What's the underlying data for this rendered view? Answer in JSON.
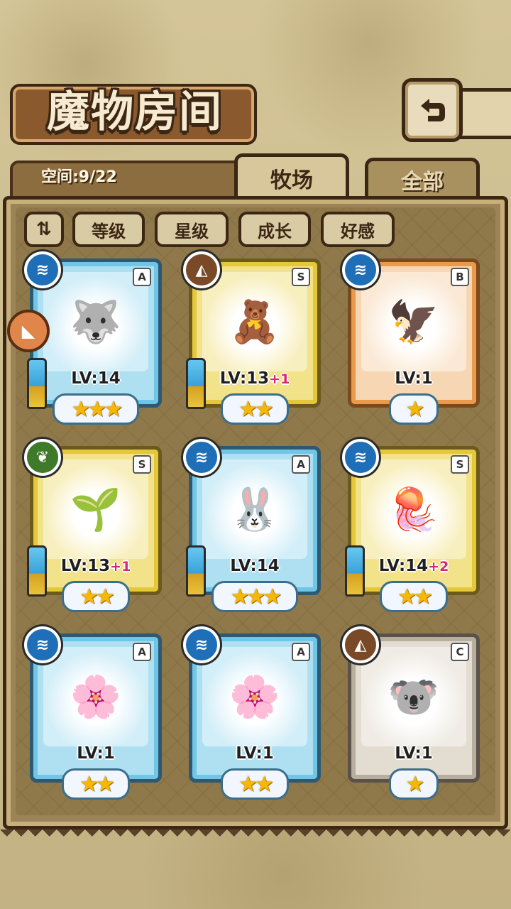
{
  "header": {
    "title": "魔物房间",
    "back_icon": "back-arrow-icon"
  },
  "info": {
    "space": "空间:9/22"
  },
  "tabs": [
    {
      "label": "牧场",
      "active": true
    },
    {
      "label": "全部",
      "active": false
    }
  ],
  "filters": {
    "sort_icon": "sort-toggle-icon",
    "items": [
      "等级",
      "星级",
      "成长",
      "好感"
    ]
  },
  "colors": {
    "water": "#1e6fb8",
    "earth": "#7a4a28",
    "wood": "#3f7a2a",
    "star": "#f6b800",
    "bonus": "#d8276f"
  },
  "monsters": [
    {
      "rank": "A",
      "element": "water",
      "level": "LV:14",
      "bonus": "",
      "stars": 3,
      "frame": "blue",
      "weapon": true,
      "portrait": "🐺"
    },
    {
      "rank": "S",
      "element": "earth",
      "level": "LV:13",
      "bonus": "+1",
      "stars": 2,
      "frame": "gold",
      "weapon": true,
      "portrait": "🧸"
    },
    {
      "rank": "B",
      "element": "water",
      "level": "LV:1",
      "bonus": "",
      "stars": 1,
      "frame": "orange",
      "weapon": false,
      "portrait": "🦅"
    },
    {
      "rank": "S",
      "element": "wood",
      "level": "LV:13",
      "bonus": "+1",
      "stars": 2,
      "frame": "gold",
      "weapon": true,
      "portrait": "🌱"
    },
    {
      "rank": "A",
      "element": "water",
      "level": "LV:14",
      "bonus": "",
      "stars": 3,
      "frame": "blue",
      "weapon": true,
      "portrait": "🐰"
    },
    {
      "rank": "S",
      "element": "water",
      "level": "LV:14",
      "bonus": "+2",
      "stars": 2,
      "frame": "gold",
      "weapon": true,
      "portrait": "🪼"
    },
    {
      "rank": "A",
      "element": "water",
      "level": "LV:1",
      "bonus": "",
      "stars": 2,
      "frame": "blue",
      "weapon": false,
      "portrait": "🌸"
    },
    {
      "rank": "A",
      "element": "water",
      "level": "LV:1",
      "bonus": "",
      "stars": 2,
      "frame": "blue",
      "weapon": false,
      "portrait": "🌸"
    },
    {
      "rank": "C",
      "element": "earth",
      "level": "LV:1",
      "bonus": "",
      "stars": 1,
      "frame": "gray",
      "weapon": false,
      "portrait": "🐨"
    }
  ]
}
